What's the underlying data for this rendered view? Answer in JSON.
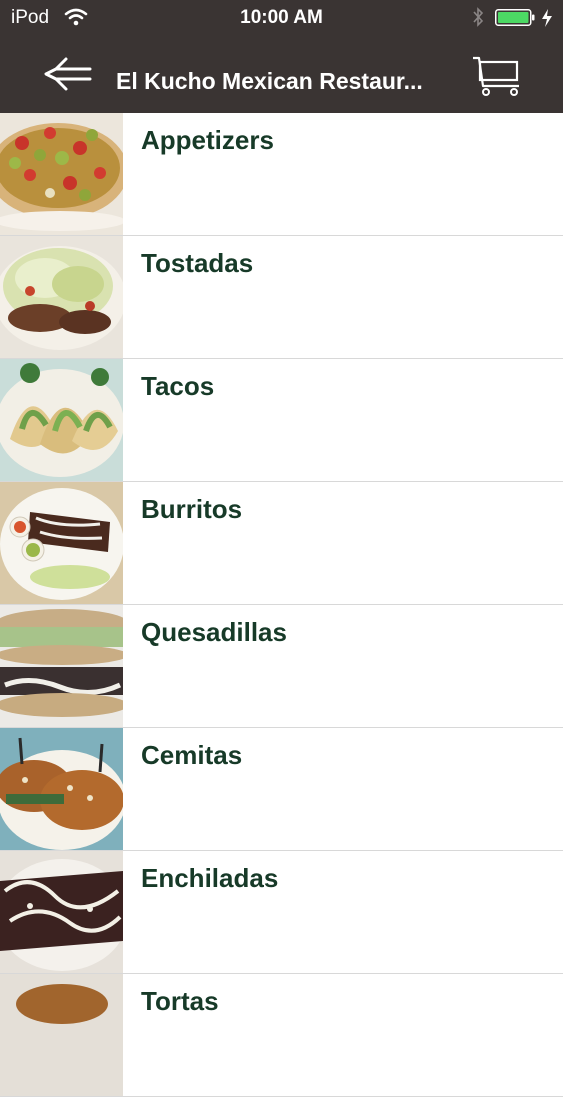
{
  "status_bar": {
    "carrier": "iPod",
    "time": "10:00 AM"
  },
  "header": {
    "title": "El Kucho Mexican Restaur..."
  },
  "menu": {
    "items": [
      {
        "label": "Appetizers"
      },
      {
        "label": "Tostadas"
      },
      {
        "label": "Tacos"
      },
      {
        "label": "Burritos"
      },
      {
        "label": "Quesadillas"
      },
      {
        "label": "Cemitas"
      },
      {
        "label": "Enchiladas"
      },
      {
        "label": "Tortas"
      }
    ]
  },
  "colors": {
    "navbar": "#3a3433",
    "label_text": "#173a28",
    "battery": "#4cd964"
  }
}
